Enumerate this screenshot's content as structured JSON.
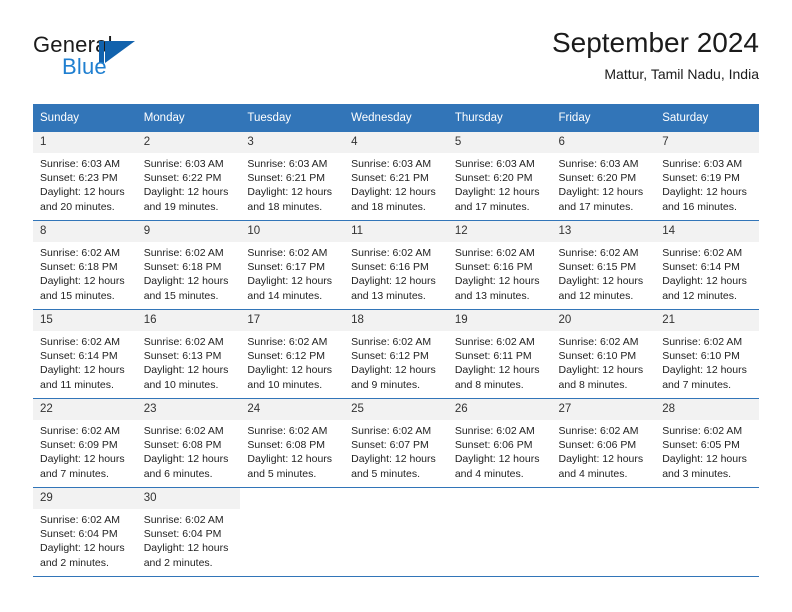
{
  "brand": {
    "word_general": "General",
    "word_blue": "Blue",
    "logo_icon": "triangle-flag-icon",
    "accent_color": "#1162ad",
    "blue_text_color": "#1f7fd0"
  },
  "header": {
    "title": "September 2024",
    "subtitle": "Mattur, Tamil Nadu, India"
  },
  "theme": {
    "header_bar_color": "#3275b8",
    "daynum_band_color": "#f2f2f2",
    "row_divider_color": "#3275b8",
    "text_color": "#222222"
  },
  "weekdays": [
    "Sunday",
    "Monday",
    "Tuesday",
    "Wednesday",
    "Thursday",
    "Friday",
    "Saturday"
  ],
  "labels": {
    "sunrise_prefix": "Sunrise:",
    "sunset_prefix": "Sunset:",
    "daylight_prefix": "Daylight:"
  },
  "weeks": [
    [
      {
        "day": "1",
        "sunrise": "Sunrise: 6:03 AM",
        "sunset": "Sunset: 6:23 PM",
        "daylight_line1": "Daylight: 12 hours",
        "daylight_line2": "and 20 minutes."
      },
      {
        "day": "2",
        "sunrise": "Sunrise: 6:03 AM",
        "sunset": "Sunset: 6:22 PM",
        "daylight_line1": "Daylight: 12 hours",
        "daylight_line2": "and 19 minutes."
      },
      {
        "day": "3",
        "sunrise": "Sunrise: 6:03 AM",
        "sunset": "Sunset: 6:21 PM",
        "daylight_line1": "Daylight: 12 hours",
        "daylight_line2": "and 18 minutes."
      },
      {
        "day": "4",
        "sunrise": "Sunrise: 6:03 AM",
        "sunset": "Sunset: 6:21 PM",
        "daylight_line1": "Daylight: 12 hours",
        "daylight_line2": "and 18 minutes."
      },
      {
        "day": "5",
        "sunrise": "Sunrise: 6:03 AM",
        "sunset": "Sunset: 6:20 PM",
        "daylight_line1": "Daylight: 12 hours",
        "daylight_line2": "and 17 minutes."
      },
      {
        "day": "6",
        "sunrise": "Sunrise: 6:03 AM",
        "sunset": "Sunset: 6:20 PM",
        "daylight_line1": "Daylight: 12 hours",
        "daylight_line2": "and 17 minutes."
      },
      {
        "day": "7",
        "sunrise": "Sunrise: 6:03 AM",
        "sunset": "Sunset: 6:19 PM",
        "daylight_line1": "Daylight: 12 hours",
        "daylight_line2": "and 16 minutes."
      }
    ],
    [
      {
        "day": "8",
        "sunrise": "Sunrise: 6:02 AM",
        "sunset": "Sunset: 6:18 PM",
        "daylight_line1": "Daylight: 12 hours",
        "daylight_line2": "and 15 minutes."
      },
      {
        "day": "9",
        "sunrise": "Sunrise: 6:02 AM",
        "sunset": "Sunset: 6:18 PM",
        "daylight_line1": "Daylight: 12 hours",
        "daylight_line2": "and 15 minutes."
      },
      {
        "day": "10",
        "sunrise": "Sunrise: 6:02 AM",
        "sunset": "Sunset: 6:17 PM",
        "daylight_line1": "Daylight: 12 hours",
        "daylight_line2": "and 14 minutes."
      },
      {
        "day": "11",
        "sunrise": "Sunrise: 6:02 AM",
        "sunset": "Sunset: 6:16 PM",
        "daylight_line1": "Daylight: 12 hours",
        "daylight_line2": "and 13 minutes."
      },
      {
        "day": "12",
        "sunrise": "Sunrise: 6:02 AM",
        "sunset": "Sunset: 6:16 PM",
        "daylight_line1": "Daylight: 12 hours",
        "daylight_line2": "and 13 minutes."
      },
      {
        "day": "13",
        "sunrise": "Sunrise: 6:02 AM",
        "sunset": "Sunset: 6:15 PM",
        "daylight_line1": "Daylight: 12 hours",
        "daylight_line2": "and 12 minutes."
      },
      {
        "day": "14",
        "sunrise": "Sunrise: 6:02 AM",
        "sunset": "Sunset: 6:14 PM",
        "daylight_line1": "Daylight: 12 hours",
        "daylight_line2": "and 12 minutes."
      }
    ],
    [
      {
        "day": "15",
        "sunrise": "Sunrise: 6:02 AM",
        "sunset": "Sunset: 6:14 PM",
        "daylight_line1": "Daylight: 12 hours",
        "daylight_line2": "and 11 minutes."
      },
      {
        "day": "16",
        "sunrise": "Sunrise: 6:02 AM",
        "sunset": "Sunset: 6:13 PM",
        "daylight_line1": "Daylight: 12 hours",
        "daylight_line2": "and 10 minutes."
      },
      {
        "day": "17",
        "sunrise": "Sunrise: 6:02 AM",
        "sunset": "Sunset: 6:12 PM",
        "daylight_line1": "Daylight: 12 hours",
        "daylight_line2": "and 10 minutes."
      },
      {
        "day": "18",
        "sunrise": "Sunrise: 6:02 AM",
        "sunset": "Sunset: 6:12 PM",
        "daylight_line1": "Daylight: 12 hours",
        "daylight_line2": "and 9 minutes."
      },
      {
        "day": "19",
        "sunrise": "Sunrise: 6:02 AM",
        "sunset": "Sunset: 6:11 PM",
        "daylight_line1": "Daylight: 12 hours",
        "daylight_line2": "and 8 minutes."
      },
      {
        "day": "20",
        "sunrise": "Sunrise: 6:02 AM",
        "sunset": "Sunset: 6:10 PM",
        "daylight_line1": "Daylight: 12 hours",
        "daylight_line2": "and 8 minutes."
      },
      {
        "day": "21",
        "sunrise": "Sunrise: 6:02 AM",
        "sunset": "Sunset: 6:10 PM",
        "daylight_line1": "Daylight: 12 hours",
        "daylight_line2": "and 7 minutes."
      }
    ],
    [
      {
        "day": "22",
        "sunrise": "Sunrise: 6:02 AM",
        "sunset": "Sunset: 6:09 PM",
        "daylight_line1": "Daylight: 12 hours",
        "daylight_line2": "and 7 minutes."
      },
      {
        "day": "23",
        "sunrise": "Sunrise: 6:02 AM",
        "sunset": "Sunset: 6:08 PM",
        "daylight_line1": "Daylight: 12 hours",
        "daylight_line2": "and 6 minutes."
      },
      {
        "day": "24",
        "sunrise": "Sunrise: 6:02 AM",
        "sunset": "Sunset: 6:08 PM",
        "daylight_line1": "Daylight: 12 hours",
        "daylight_line2": "and 5 minutes."
      },
      {
        "day": "25",
        "sunrise": "Sunrise: 6:02 AM",
        "sunset": "Sunset: 6:07 PM",
        "daylight_line1": "Daylight: 12 hours",
        "daylight_line2": "and 5 minutes."
      },
      {
        "day": "26",
        "sunrise": "Sunrise: 6:02 AM",
        "sunset": "Sunset: 6:06 PM",
        "daylight_line1": "Daylight: 12 hours",
        "daylight_line2": "and 4 minutes."
      },
      {
        "day": "27",
        "sunrise": "Sunrise: 6:02 AM",
        "sunset": "Sunset: 6:06 PM",
        "daylight_line1": "Daylight: 12 hours",
        "daylight_line2": "and 4 minutes."
      },
      {
        "day": "28",
        "sunrise": "Sunrise: 6:02 AM",
        "sunset": "Sunset: 6:05 PM",
        "daylight_line1": "Daylight: 12 hours",
        "daylight_line2": "and 3 minutes."
      }
    ],
    [
      {
        "day": "29",
        "sunrise": "Sunrise: 6:02 AM",
        "sunset": "Sunset: 6:04 PM",
        "daylight_line1": "Daylight: 12 hours",
        "daylight_line2": "and 2 minutes."
      },
      {
        "day": "30",
        "sunrise": "Sunrise: 6:02 AM",
        "sunset": "Sunset: 6:04 PM",
        "daylight_line1": "Daylight: 12 hours",
        "daylight_line2": "and 2 minutes."
      },
      {
        "day": "",
        "sunrise": "",
        "sunset": "",
        "daylight_line1": "",
        "daylight_line2": ""
      },
      {
        "day": "",
        "sunrise": "",
        "sunset": "",
        "daylight_line1": "",
        "daylight_line2": ""
      },
      {
        "day": "",
        "sunrise": "",
        "sunset": "",
        "daylight_line1": "",
        "daylight_line2": ""
      },
      {
        "day": "",
        "sunrise": "",
        "sunset": "",
        "daylight_line1": "",
        "daylight_line2": ""
      },
      {
        "day": "",
        "sunrise": "",
        "sunset": "",
        "daylight_line1": "",
        "daylight_line2": ""
      }
    ]
  ]
}
